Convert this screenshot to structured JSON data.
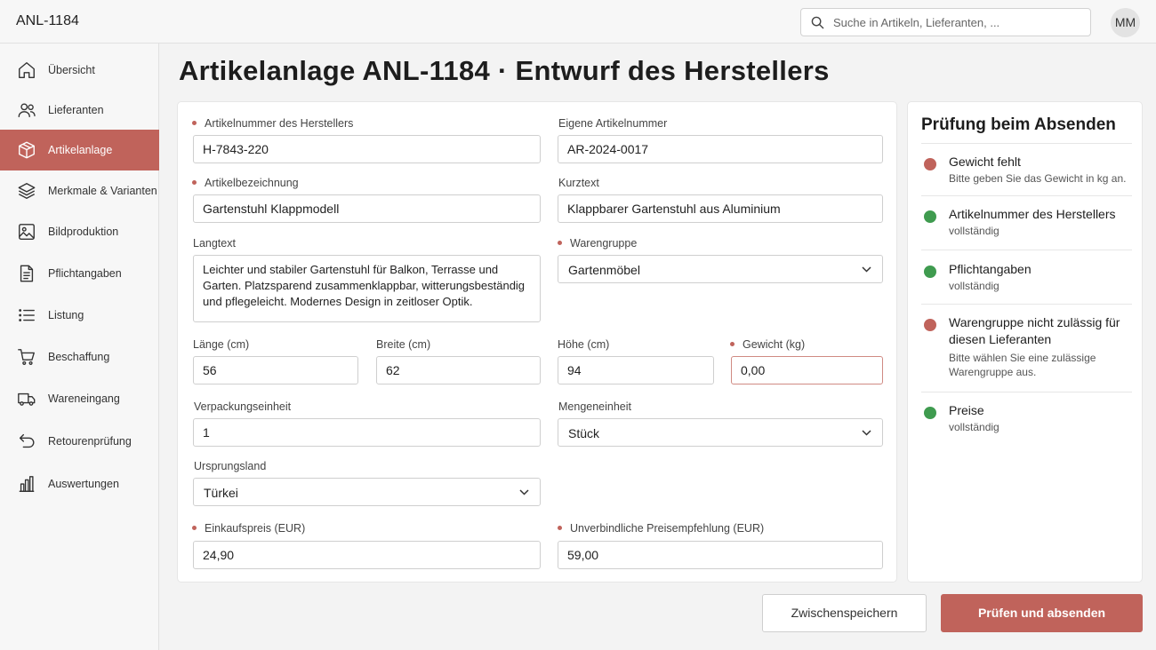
{
  "app": {
    "record_id": "ANL-1184"
  },
  "search": {
    "placeholder": "Suche in Artikeln, Lieferanten, ..."
  },
  "user": {
    "initials": "MM"
  },
  "sidebar": {
    "items": [
      {
        "label": "Übersicht",
        "icon": "home-icon"
      },
      {
        "label": "Lieferanten",
        "icon": "users-icon"
      },
      {
        "label": "Artikelanlage",
        "icon": "box-icon",
        "active": true
      },
      {
        "label": "Merkmale & Varianten",
        "icon": "layers-icon"
      },
      {
        "label": "Bildproduktion",
        "icon": "image-icon"
      },
      {
        "label": "Pflichtangaben",
        "icon": "document-icon"
      },
      {
        "label": "Listung",
        "icon": "list-icon"
      },
      {
        "label": "Beschaffung",
        "icon": "cart-icon"
      },
      {
        "label": "Wareneingang",
        "icon": "truck-icon"
      },
      {
        "label": "Retourenprüfung",
        "icon": "return-icon"
      },
      {
        "label": "Auswertungen",
        "icon": "bar-chart-icon"
      }
    ]
  },
  "page": {
    "title": "Artikelanlage ANL-1184 · Entwurf des Herstellers"
  },
  "form": {
    "manufacturer_sku": {
      "label": "Artikelnummer des Herstellers",
      "value": "H-7843-220"
    },
    "own_sku": {
      "label": "Eigene Artikelnummer",
      "value": "AR-2024-0017"
    },
    "name": {
      "label": "Artikelbezeichnung",
      "value": "Gartenstuhl Klappmodell"
    },
    "short_text": {
      "label": "Kurztext",
      "value": "Klappbarer Gartenstuhl aus Aluminium"
    },
    "long_text": {
      "label": "Langtext",
      "value": "Leichter und stabiler Gartenstuhl für Balkon, Terrasse und Garten. Platzsparend zusammenklappbar, witterungsbeständig und pflegeleicht. Modernes Design in zeitloser Optik."
    },
    "product_group": {
      "label": "Warengruppe",
      "value": "Gartenmöbel"
    },
    "length": {
      "label": "Länge (cm)",
      "value": "56"
    },
    "width": {
      "label": "Breite (cm)",
      "value": "62"
    },
    "height": {
      "label": "Höhe (cm)",
      "value": "94"
    },
    "weight": {
      "label": "Gewicht (kg)",
      "value": "0,00"
    },
    "packaging_unit": {
      "label": "Verpackungseinheit",
      "value": "1"
    },
    "quantity_unit": {
      "label": "Mengeneinheit",
      "value": "Stück"
    },
    "origin": {
      "label": "Ursprungsland",
      "value": "Türkei"
    },
    "purchase_price": {
      "label": "Einkaufspreis (EUR)",
      "value": "24,90"
    },
    "rrp": {
      "label": "Unverbindliche Preisempfehlung (EUR)",
      "value": "59,00"
    }
  },
  "checks": {
    "title": "Prüfung beim Absenden",
    "items": [
      {
        "title": "Gewicht fehlt",
        "detail": "Bitte geben Sie das Gewicht in kg an.",
        "status": "error"
      },
      {
        "title": "Artikelnummer des Herstellers",
        "detail": "vollständig",
        "status": "ok"
      },
      {
        "title": "Pflichtangaben",
        "detail": "vollständig",
        "status": "ok"
      },
      {
        "title": "Warengruppe nicht zulässig für diesen Lieferanten",
        "detail": "Bitte wählen Sie eine zulässige Warengruppe aus.",
        "status": "error"
      },
      {
        "title": "Preise",
        "detail": "vollständig",
        "status": "ok"
      }
    ],
    "colors": {
      "ok": "#3f9b4f",
      "error": "#c0635b"
    }
  },
  "actions": {
    "save_draft": "Zwischenspeichern",
    "submit": "Prüfen und absenden"
  },
  "theme": {
    "accent": "#c0635b"
  }
}
